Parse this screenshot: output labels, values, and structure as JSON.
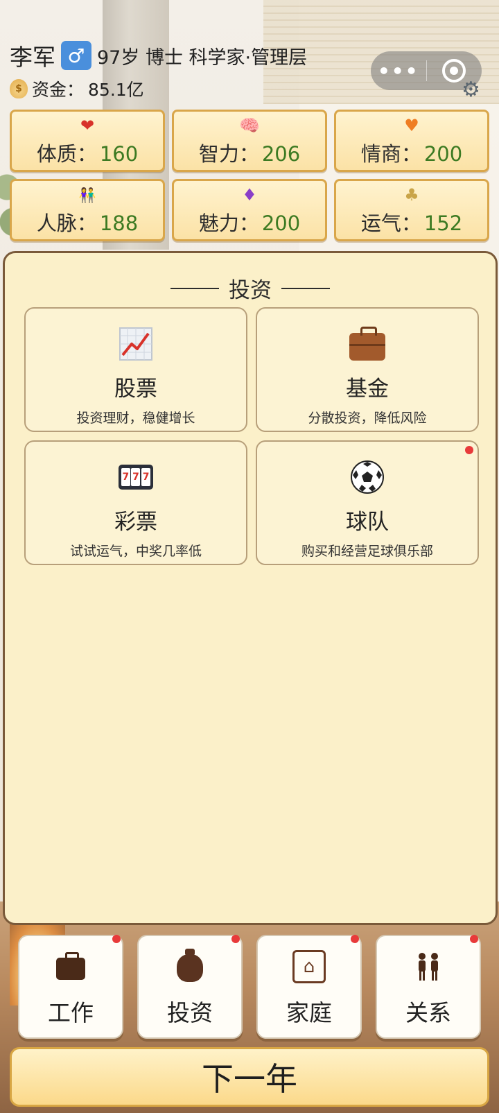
{
  "player": {
    "name": "李军",
    "gender_symbol": "♂",
    "info": "97岁 博士 科学家·管理层",
    "money_label": "资金：",
    "money_value": "85.1亿"
  },
  "capsule": {
    "more_symbol": "•••"
  },
  "stats": [
    {
      "label": "体质：",
      "value": "160",
      "icon": "heart-icon",
      "icon_char": "❤",
      "icon_color": "#d8322a"
    },
    {
      "label": "智力：",
      "value": "206",
      "icon": "brain-icon",
      "icon_char": "🧠",
      "icon_color": "#3d7fc8"
    },
    {
      "label": "情商：",
      "value": "200",
      "icon": "smile-heart-icon",
      "icon_char": "♥",
      "icon_color": "#ef7d22"
    },
    {
      "label": "人脉：",
      "value": "188",
      "icon": "people-icon",
      "icon_char": "👫",
      "icon_color": "#3c8a3c"
    },
    {
      "label": "魅力：",
      "value": "200",
      "icon": "diamond-icon",
      "icon_char": "♦",
      "icon_color": "#8a3ec8"
    },
    {
      "label": "运气：",
      "value": "152",
      "icon": "clover-icon",
      "icon_char": "♣",
      "icon_color": "#c9a448"
    }
  ],
  "panel": {
    "title": "投资",
    "cards": [
      {
        "title": "股票",
        "desc": "投资理财，稳健增长",
        "icon": "stock-chart-icon",
        "badge": false
      },
      {
        "title": "基金",
        "desc": "分散投资，降低风险",
        "icon": "briefcase-icon",
        "badge": false
      },
      {
        "title": "彩票",
        "desc": "试试运气，中奖几率低",
        "icon": "slot-machine-icon",
        "badge": false
      },
      {
        "title": "球队",
        "desc": "购买和经营足球俱乐部",
        "icon": "soccer-ball-icon",
        "badge": true
      }
    ]
  },
  "nav": [
    {
      "label": "工作",
      "icon": "briefcase-icon"
    },
    {
      "label": "投资",
      "icon": "money-bag-icon"
    },
    {
      "label": "家庭",
      "icon": "home-icon"
    },
    {
      "label": "关系",
      "icon": "people-icon"
    }
  ],
  "next_year": "下一年"
}
